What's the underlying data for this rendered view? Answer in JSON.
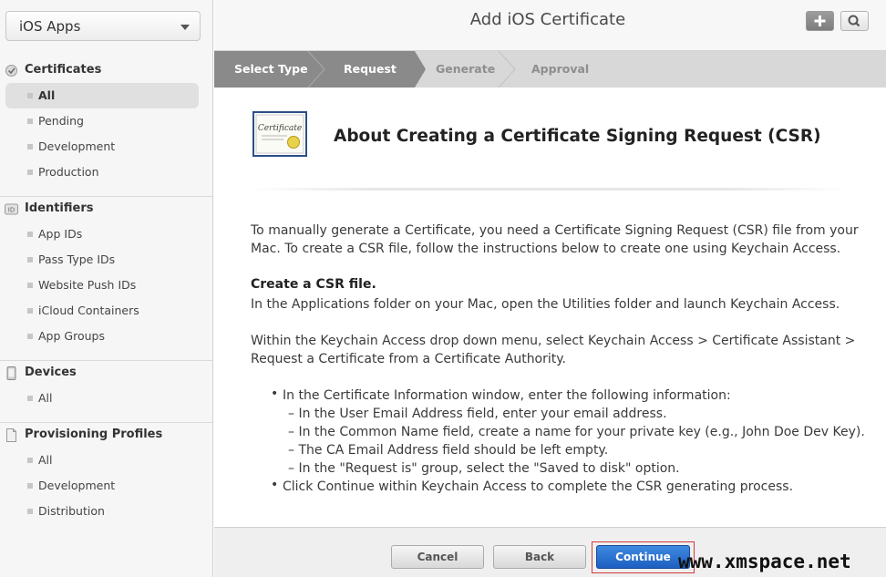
{
  "sidebar": {
    "app_select": "iOS Apps",
    "sections": [
      {
        "title": "Certificates",
        "icon": "certificate-icon",
        "items": [
          "All",
          "Pending",
          "Development",
          "Production"
        ]
      },
      {
        "title": "Identifiers",
        "icon": "id-icon",
        "items": [
          "App IDs",
          "Pass Type IDs",
          "Website Push IDs",
          "iCloud Containers",
          "App Groups"
        ]
      },
      {
        "title": "Devices",
        "icon": "device-icon",
        "items": [
          "All"
        ]
      },
      {
        "title": "Provisioning Profiles",
        "icon": "profile-icon",
        "items": [
          "All",
          "Development",
          "Distribution"
        ]
      }
    ]
  },
  "header": {
    "title": "Add iOS Certificate"
  },
  "steps": [
    "Select Type",
    "Request",
    "Generate",
    "Approval"
  ],
  "content": {
    "icon_text": "Certificate",
    "title": "About Creating a Certificate Signing Request (CSR)",
    "intro_1": "To manually generate a Certificate, you need a Certificate Signing Request (CSR) file from your",
    "intro_2": "Mac. To create a CSR file, follow the instructions below to create one using Keychain Access.",
    "create_heading": "Create a CSR file.",
    "create_text": "In the Applications folder on your Mac, open the Utilities folder and launch Keychain Access.",
    "within_1": "Within the Keychain Access drop down menu, select Keychain Access > Certificate Assistant >",
    "within_2": "Request a Certificate from a Certificate Authority.",
    "bullet_1": "In the Certificate Information window, enter the following information:",
    "sub_1": "– In the User Email Address field, enter your email address.",
    "sub_2": "– In the Common Name field, create a name for your private key (e.g., John Doe Dev Key).",
    "sub_3": "– The CA Email Address field should be left empty.",
    "sub_4": "– In the \"Request is\" group, select the \"Saved to disk\" option.",
    "bullet_2": "Click Continue within Keychain Access to complete the CSR generating process."
  },
  "footer": {
    "cancel": "Cancel",
    "back": "Back",
    "continue": "Continue"
  },
  "watermark": "www.xmspace.net",
  "colors": {
    "accent": "#1d5fc2",
    "steps_done": "#8a8a8a",
    "steps_todo": "#d8d8d8"
  }
}
